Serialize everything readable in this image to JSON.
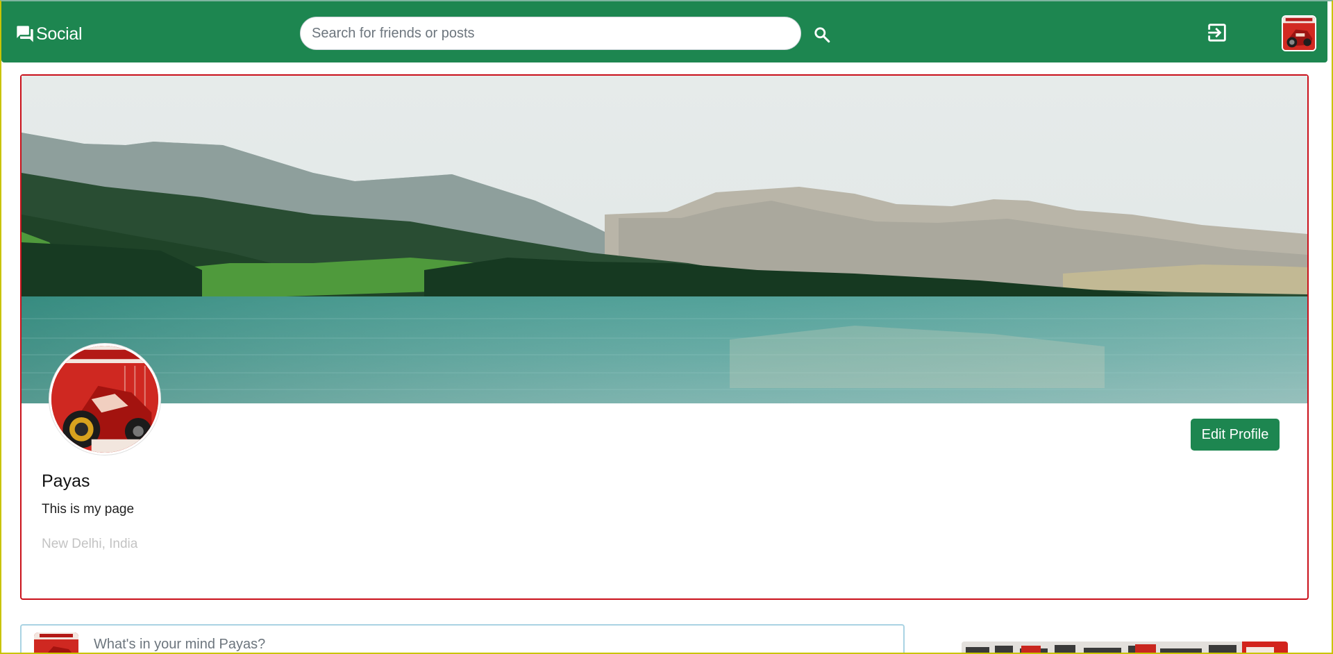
{
  "navbar": {
    "brand_label": "Social",
    "brand_icon": "chat-bubbles-icon",
    "search_placeholder": "Search for friends or posts",
    "search_icon": "search-icon",
    "logout_icon": "logout-icon",
    "avatar_icon": "user-avatar"
  },
  "profile": {
    "name": "Payas",
    "bio": "This is my page",
    "location": "New Delhi, India",
    "edit_button_label": "Edit Profile"
  },
  "composer": {
    "placeholder": "What's in your mind Payas?"
  },
  "colors": {
    "primary": "#1d8650",
    "card_border": "#c9101a",
    "composer_border": "#a9d3e3",
    "muted_text": "#c3c3c3"
  }
}
